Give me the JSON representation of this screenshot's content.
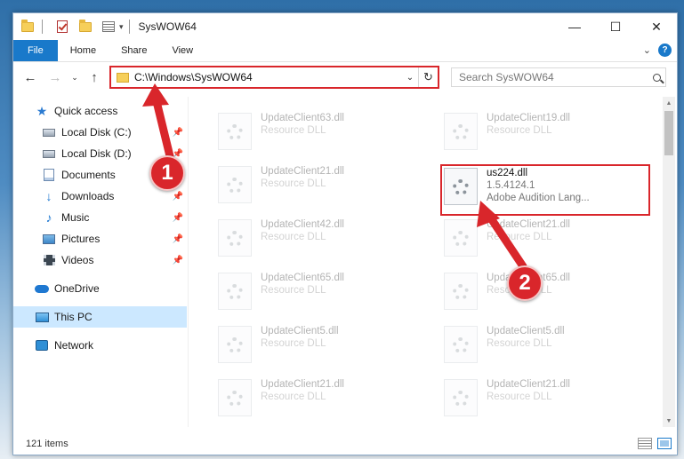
{
  "window": {
    "title": "SysWOW64",
    "controls": {
      "minimize": "—",
      "maximize": "☐",
      "close": "✕"
    }
  },
  "ribbon": {
    "tabs": [
      "File",
      "Home",
      "Share",
      "View"
    ]
  },
  "nav": {
    "back": "←",
    "forward": "→",
    "recent": "⌄",
    "up": "↑",
    "address": "C:\\Windows\\SysWOW64",
    "search_placeholder": "Search SysWOW64"
  },
  "sidebar": {
    "items": [
      {
        "label": "Quick access",
        "icon": "star-icon",
        "pinned": false
      },
      {
        "label": "Local Disk (C:)",
        "icon": "drive-icon",
        "pinned": true
      },
      {
        "label": "Local Disk (D:)",
        "icon": "drive-icon",
        "pinned": true
      },
      {
        "label": "Documents",
        "icon": "documents-icon",
        "pinned": true
      },
      {
        "label": "Downloads",
        "icon": "download-icon",
        "pinned": true
      },
      {
        "label": "Music",
        "icon": "music-icon",
        "pinned": true
      },
      {
        "label": "Pictures",
        "icon": "pictures-icon",
        "pinned": true
      },
      {
        "label": "Videos",
        "icon": "videos-icon",
        "pinned": true
      },
      {
        "label": "OneDrive",
        "icon": "onedrive-icon",
        "pinned": false
      },
      {
        "label": "This PC",
        "icon": "this-pc-icon",
        "pinned": false,
        "selected": true
      },
      {
        "label": "Network",
        "icon": "network-icon",
        "pinned": false
      }
    ]
  },
  "files": {
    "left": [
      {
        "name": "UpdateClient63.dll",
        "type": "Resource DLL"
      },
      {
        "name": "UpdateClient21.dll",
        "type": "Resource DLL"
      },
      {
        "name": "UpdateClient42.dll",
        "type": "Resource DLL"
      },
      {
        "name": "UpdateClient65.dll",
        "type": "Resource DLL"
      },
      {
        "name": "UpdateClient5.dll",
        "type": "Resource DLL"
      },
      {
        "name": "UpdateClient21.dll",
        "type": "Resource DLL"
      }
    ],
    "right": [
      {
        "name": "UpdateClient19.dll",
        "type": "Resource DLL"
      },
      {
        "name": "UpdateClient21.dll",
        "type": "Resource DLL"
      },
      {
        "name": "UpdateClient65.dll",
        "type": "Resource DLL"
      },
      {
        "name": "UpdateClient5.dll",
        "type": "Resource DLL"
      },
      {
        "name": "UpdateClient21.dll",
        "type": "Resource DLL"
      }
    ],
    "highlighted": {
      "name": "us224.dll",
      "version": "1.5.4124.1",
      "description": "Adobe Audition Lang..."
    }
  },
  "status": {
    "item_count": "121 items"
  },
  "annotations": {
    "step1": "1",
    "step2": "2",
    "color": "#d9262b"
  }
}
